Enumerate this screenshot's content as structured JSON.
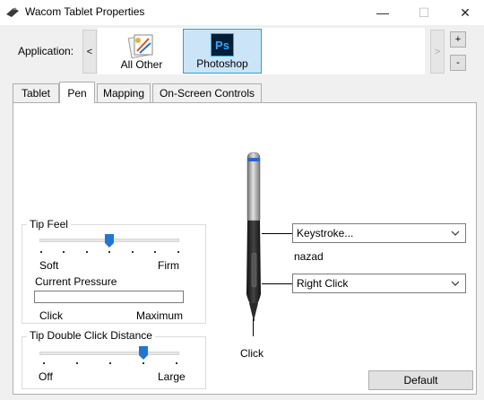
{
  "window": {
    "title": "Wacom Tablet Properties",
    "controls": {
      "minimize": "—",
      "maximize": "☐",
      "close": "✕"
    }
  },
  "application": {
    "label": "Application:",
    "prev": "<",
    "next": ">",
    "add": "+",
    "remove": "-",
    "tiles": [
      {
        "label": "All Other",
        "icon": "all-other-apps-icon"
      },
      {
        "label": "Photoshop",
        "icon": "photoshop-icon",
        "icon_text": "Ps",
        "selected": true
      }
    ]
  },
  "tabs": [
    {
      "label": "Tablet"
    },
    {
      "label": "Pen",
      "active": true
    },
    {
      "label": "Mapping"
    },
    {
      "label": "On-Screen Controls"
    }
  ],
  "tip_feel": {
    "title": "Tip Feel",
    "min_label": "Soft",
    "max_label": "Firm",
    "level": 0.5,
    "pressure_label": "Current Pressure",
    "pressure_min": "Click",
    "pressure_max": "Maximum"
  },
  "double_click": {
    "title": "Tip Double Click Distance",
    "min_label": "Off",
    "max_label": "Large",
    "level": 0.75
  },
  "pen_buttons": {
    "upper": {
      "value": "Keystroke...",
      "sub": "nazad"
    },
    "lower": {
      "value": "Right Click"
    },
    "tip": "Click"
  },
  "footer": {
    "default_label": "Default"
  },
  "colors": {
    "selection_bg": "#cce4f7",
    "selection_border": "#26a0da",
    "slider_thumb": "#1e77d3",
    "photoshop_bg": "#001e36",
    "photoshop_fg": "#31a8ff"
  }
}
